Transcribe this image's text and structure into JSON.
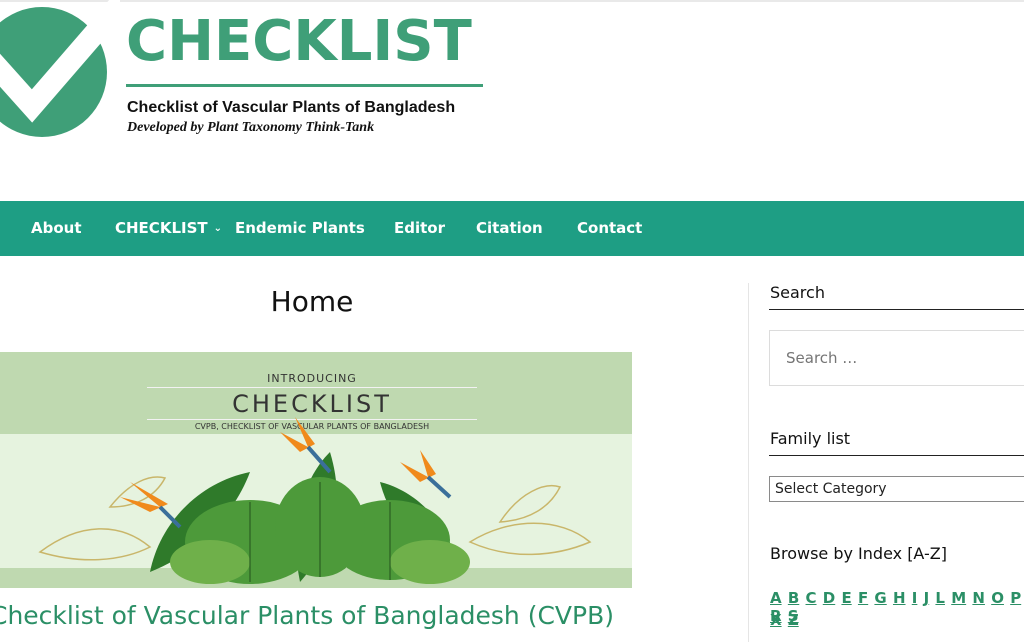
{
  "logo": {
    "wordmark": "CHECKLIST",
    "subtitle": "Checklist of Vascular Plants of Bangladesh",
    "developer": "Developed by Plant Taxonomy Think-Tank",
    "icon": "checkmark-circle-icon",
    "color": "#3f9f78"
  },
  "nav": {
    "background": "#1e9e84",
    "items": [
      {
        "label": "About"
      },
      {
        "label": "CHECKLIST",
        "icon": "chevron-down-icon"
      },
      {
        "label": "Endemic Plants"
      },
      {
        "label": "Editor"
      },
      {
        "label": "Citation"
      },
      {
        "label": "Contact"
      }
    ]
  },
  "main": {
    "page_title": "Home",
    "banner": {
      "intro": "INTRODUCING",
      "word": "CHECKLIST",
      "sub": "CVPB, CHECKLIST OF VASCULAR PLANTS OF BANGLADESH"
    },
    "article_title": "Checklist of Vascular Plants of Bangladesh (CVPB)"
  },
  "sidebar": {
    "search": {
      "title": "Search",
      "placeholder": "Search …"
    },
    "family": {
      "title": "Family list",
      "selected": "Select Category"
    },
    "browse": {
      "title": "Browse by Index [A-Z]",
      "row1": [
        "A",
        "B",
        "C",
        "D",
        "E",
        "F",
        "G",
        "H",
        "I",
        "J",
        "L",
        "M",
        "N",
        "O",
        "P",
        "R",
        "S"
      ],
      "row2": [
        "X",
        "Z"
      ]
    }
  }
}
